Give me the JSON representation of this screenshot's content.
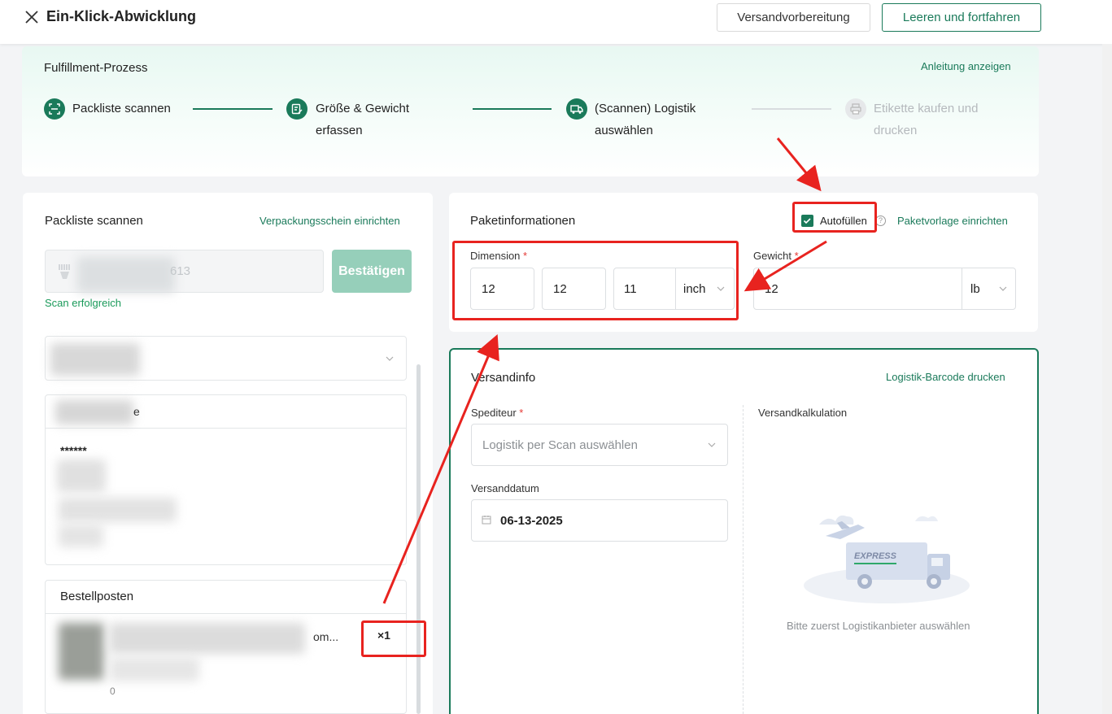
{
  "header": {
    "title": "Ein-Klick-Abwicklung",
    "prep_button": "Versandvorbereitung",
    "continue_button": "Leeren und fortfahren"
  },
  "process": {
    "title": "Fulfillment-Prozess",
    "guide_link": "Anleitung anzeigen",
    "steps": [
      {
        "line1": "Packliste scannen",
        "line2": "",
        "icon": "scan-icon",
        "state": "done"
      },
      {
        "line1": "Größe & Gewicht",
        "line2": "erfassen",
        "icon": "edit-form-icon",
        "state": "done"
      },
      {
        "line1": "(Scannen) Logistik",
        "line2": "auswählen",
        "icon": "truck-icon",
        "state": "active"
      },
      {
        "line1": "Etikette kaufen und",
        "line2": "drucken",
        "icon": "printer-icon",
        "state": "disabled"
      }
    ]
  },
  "packlist": {
    "title": "Packliste scannen",
    "setup_link": "Verpackungsschein einrichten",
    "scan_value": "613",
    "confirm_button": "Bestätigen",
    "status": "Scan erfolgreich",
    "address_partial": "e",
    "masked": "******",
    "order_items_title": "Bestellposten",
    "item_name_suffix": "om...",
    "item_qty": "×1",
    "item_sub": "0"
  },
  "package": {
    "title": "Paketinformationen",
    "autofill_label": "Autofüllen",
    "template_link": "Paketvorlage einrichten",
    "dimension_label": "Dimension",
    "dim_length": "12",
    "dim_width": "12",
    "dim_height": "11",
    "dim_unit": "inch",
    "weight_label": "Gewicht",
    "weight_value": "12",
    "weight_unit": "lb"
  },
  "shipping": {
    "title": "Versandinfo",
    "barcode_link": "Logistik-Barcode drucken",
    "carrier_label": "Spediteur",
    "carrier_placeholder": "Logistik per Scan auswählen",
    "date_label": "Versanddatum",
    "date_value": "06-13-2025",
    "calc_label": "Versandkalkulation",
    "express_text": "EXPRESS",
    "empty_hint": "Bitte zuerst Logistikanbieter auswählen"
  },
  "colors": {
    "brand": "#1a7a5a",
    "annotation": "#e8231f",
    "required": "#e53935"
  }
}
